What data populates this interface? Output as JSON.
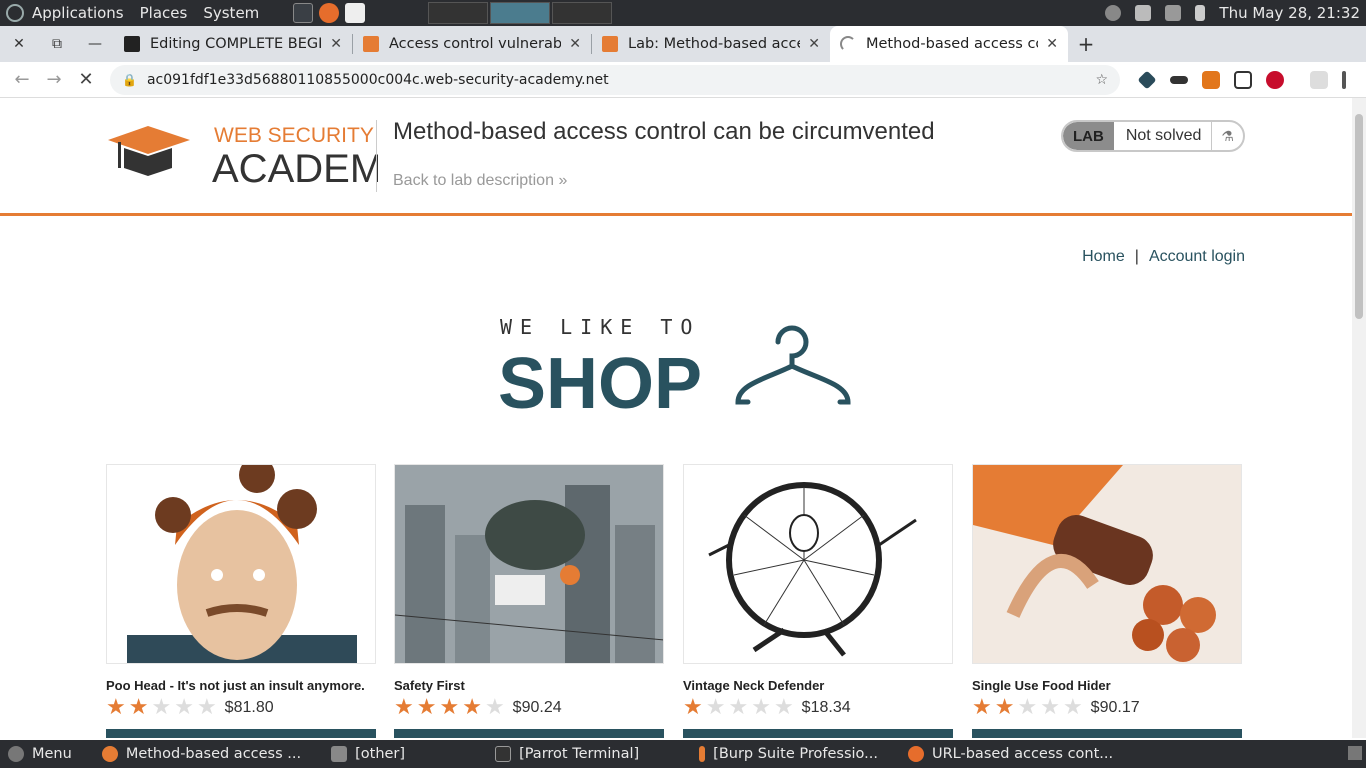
{
  "os_panel": {
    "menus": [
      "Applications",
      "Places",
      "System"
    ],
    "clock": "Thu May 28, 21:32"
  },
  "browser": {
    "tabs": [
      {
        "title": "Editing COMPLETE BEGIN",
        "active": false
      },
      {
        "title": "Access control vulnerabilit",
        "active": false
      },
      {
        "title": "Lab: Method-based acces",
        "active": false
      },
      {
        "title": "Method-based access con",
        "active": true
      }
    ],
    "url": "ac091fdf1e33d56880110855000c004c.web-security-academy.net"
  },
  "academy_header": {
    "logo_line1": "WEB SECURITY",
    "logo_line2": "ACADEMY",
    "lab_title": "Method-based access control can be circumvented",
    "back_link": "Back to lab description",
    "lab_badge": "LAB",
    "lab_state": "Not solved"
  },
  "nav": {
    "home": "Home",
    "separator": "|",
    "account_login": "Account login"
  },
  "shop_logo": {
    "line1": "WE LIKE TO",
    "line2": "SHOP"
  },
  "products": [
    {
      "name": "Poo Head - It's not just an insult anymore.",
      "rating": 2,
      "price": "$81.80"
    },
    {
      "name": "Safety First",
      "rating": 4,
      "price": "$90.24"
    },
    {
      "name": "Vintage Neck Defender",
      "rating": 1,
      "price": "$18.34"
    },
    {
      "name": "Single Use Food Hider",
      "rating": 2,
      "price": "$90.17"
    }
  ],
  "taskbar": {
    "menu": "Menu",
    "tasks": [
      "Method-based access ...",
      "[other]",
      "[Parrot Terminal]",
      "[Burp Suite Professio...",
      "URL-based access cont..."
    ]
  },
  "colors": {
    "accent_orange": "#e57c34",
    "brand_teal": "#29525f"
  }
}
